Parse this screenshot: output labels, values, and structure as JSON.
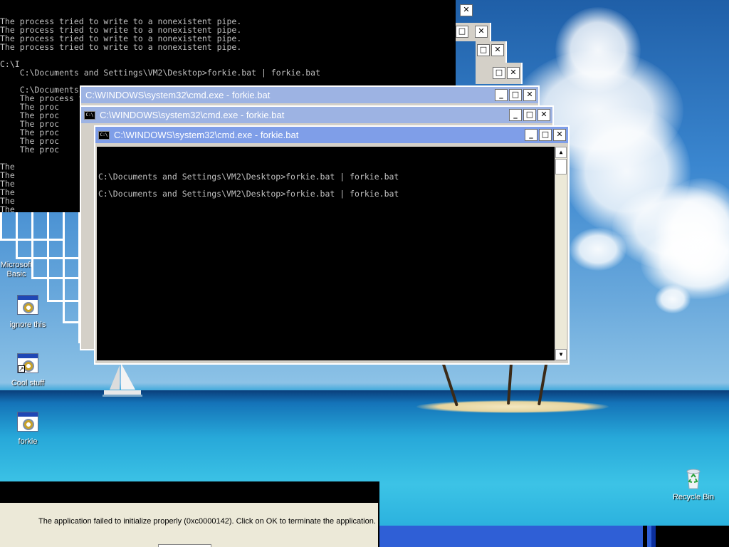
{
  "desktop": {
    "icons": [
      {
        "label": "Microsoft\nBasic"
      },
      {
        "label": "ignore this"
      },
      {
        "label": "Cool stuff"
      },
      {
        "label": "forkie"
      },
      {
        "label": "Recycle Bin"
      }
    ]
  },
  "cmd_icon_text": "C:\\",
  "back_console": {
    "lines": [
      "The process tried to write to a nonexistent pipe.",
      "The process tried to write to a nonexistent pipe.",
      "The process tried to write to a nonexistent pipe.",
      "The process tried to write to a nonexistent pipe.",
      "",
      "C:\\I",
      "    C:\\Documents and Settings\\VM2\\Desktop>forkie.bat | forkie.bat",
      "",
      "    C:\\Documents and Settings\\VM2\\Desktop>forkie.bat | forkie.bat",
      "    The process tried to write to a nonexistent pipe.",
      "    The proc",
      "    The proc",
      "    The proc",
      "    The proc",
      "    The proc",
      "    The proc",
      "",
      "The",
      "The",
      "The",
      "The",
      "The",
      "The",
      "The"
    ]
  },
  "windows": [
    {
      "title": "C:\\WINDOWS\\system32\\cmd.exe - forkie.bat"
    },
    {
      "title": "C:\\WINDOWS\\system32\\cmd.exe - forkie.bat"
    },
    {
      "title": "C:\\WINDOWS\\system32\\cmd.exe - forkie.bat"
    }
  ],
  "front_console": {
    "lines": [
      "",
      "C:\\Documents and Settings\\VM2\\Desktop>forkie.bat | forkie.bat",
      "",
      "C:\\Documents and Settings\\VM2\\Desktop>forkie.bat | forkie.bat"
    ]
  },
  "window_controls": {
    "minimize": "_",
    "maximize": "□",
    "close": "✕"
  },
  "scroll": {
    "up": "▲",
    "down": "▼"
  },
  "dialog": {
    "message": "The application failed to initialize properly (0xc0000142). Click on OK to terminate the application."
  }
}
